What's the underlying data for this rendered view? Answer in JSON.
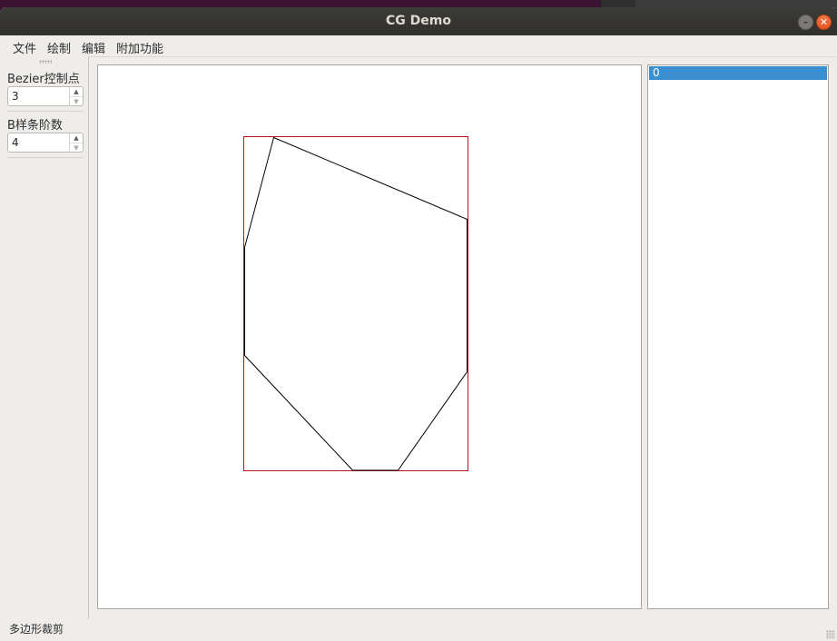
{
  "window": {
    "title": "CG Demo",
    "minimize_icon": "minimize-icon",
    "close_icon": "close-icon"
  },
  "menu": {
    "items": [
      {
        "label": "文件"
      },
      {
        "label": "绘制"
      },
      {
        "label": "编辑"
      },
      {
        "label": "附加功能"
      }
    ]
  },
  "dock": {
    "bezier_label": "Bezier控制点数",
    "bezier_value": "3",
    "bspline_label": "B样条阶数",
    "bspline_value": "4"
  },
  "canvas": {
    "clip_rect_color": "#c0101a",
    "polygon_color": "#000000"
  },
  "list": {
    "items": [
      {
        "label": "0",
        "selected": true
      }
    ],
    "selection_color": "#3a8fd0"
  },
  "status": {
    "message": "多边形裁剪"
  }
}
